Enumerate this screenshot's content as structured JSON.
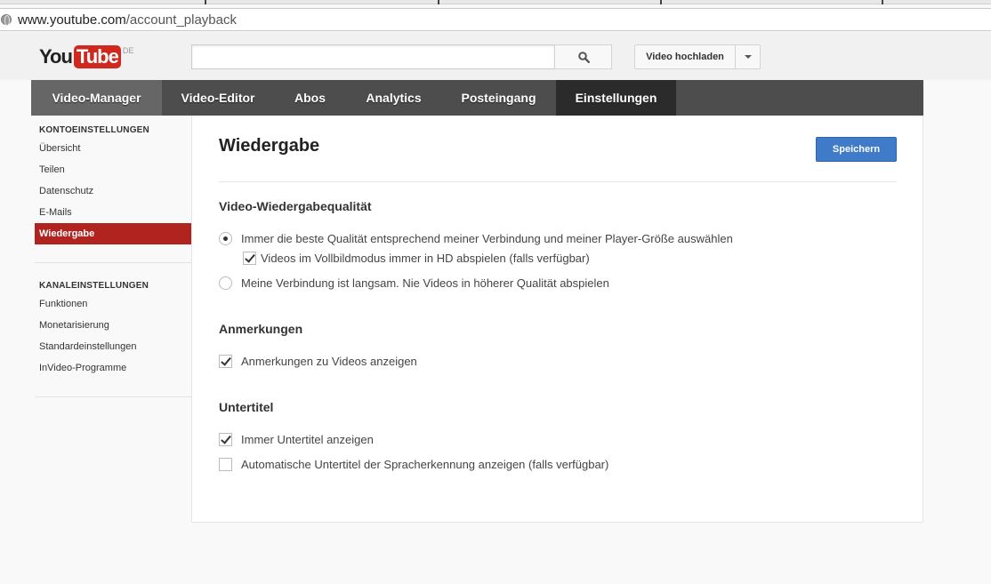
{
  "browser": {
    "url_domain": "www.youtube.com",
    "url_path": "/account_playback"
  },
  "header": {
    "logo_you": "You",
    "logo_tube": "Tube",
    "logo_region": "DE",
    "search_placeholder": "",
    "upload_label": "Video hochladen"
  },
  "nav": {
    "items": [
      "Video-Manager",
      "Video-Editor",
      "Abos",
      "Analytics",
      "Posteingang",
      "Einstellungen"
    ],
    "active": "Einstellungen"
  },
  "sidebar": {
    "account_heading": "KONTOEINSTELLUNGEN",
    "account_items": [
      "Übersicht",
      "Teilen",
      "Datenschutz",
      "E-Mails",
      "Wiedergabe"
    ],
    "channel_heading": "KANALEINSTELLUNGEN",
    "channel_items": [
      "Funktionen",
      "Monetarisierung",
      "Standardeinstellungen",
      "InVideo-Programme"
    ],
    "active": "Wiedergabe"
  },
  "main": {
    "title": "Wiedergabe",
    "save_label": "Speichern",
    "quality": {
      "heading": "Video-Wiedergabequalität",
      "option_best": "Immer die beste Qualität entsprechend meiner Verbindung und meiner Player-Größe auswählen",
      "option_best_checked": true,
      "option_hd": "Videos im Vollbildmodus immer in HD abspielen (falls verfügbar)",
      "option_hd_checked": true,
      "option_slow": "Meine Verbindung ist langsam. Nie Videos in höherer Qualität abspielen",
      "option_slow_checked": false
    },
    "annotations": {
      "heading": "Anmerkungen",
      "option_show": "Anmerkungen zu Videos anzeigen",
      "option_show_checked": true
    },
    "subtitles": {
      "heading": "Untertitel",
      "option_always": "Immer Untertitel anzeigen",
      "option_always_checked": true,
      "option_auto": "Automatische Untertitel der Spracherkennung anzeigen (falls verfügbar)",
      "option_auto_checked": false
    }
  },
  "colors": {
    "accent_red": "#b0231e",
    "nav_bg": "#4d4d4d",
    "save_blue": "#3f7bc8"
  }
}
